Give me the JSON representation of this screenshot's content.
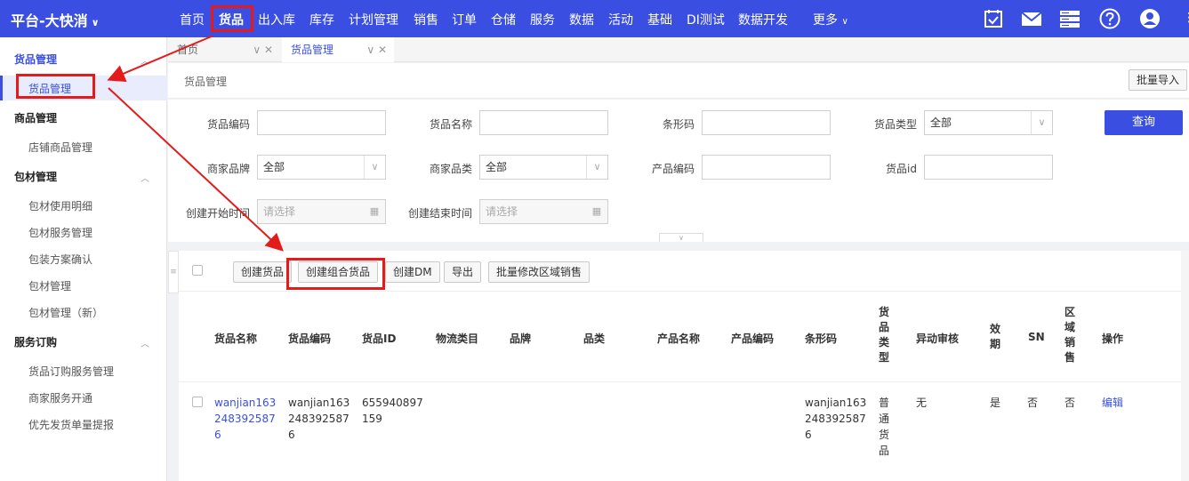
{
  "topnav": {
    "brand": "平台-大快消",
    "items": [
      "首页",
      "货品",
      "出入库",
      "库存",
      "计划管理",
      "销售",
      "订单",
      "仓储",
      "服务",
      "数据",
      "活动",
      "基础",
      "DI测试",
      "数据开发",
      "更多"
    ],
    "active": "货品",
    "icons": [
      "calendar-check-icon",
      "mail-icon",
      "server-icon",
      "help-icon",
      "user-icon"
    ]
  },
  "sidebar": {
    "groups": [
      {
        "title": "货品管理",
        "items": [
          "货品管理"
        ]
      },
      {
        "title": "商品管理",
        "items": [
          "店铺商品管理"
        ]
      },
      {
        "title": "包材管理",
        "items": [
          "包材使用明细",
          "包材服务管理",
          "包装方案确认",
          "包材管理",
          "包材管理（新）"
        ]
      },
      {
        "title": "服务订购",
        "items": [
          "货品订购服务管理",
          "商家服务开通",
          "优先发货单量提报"
        ]
      }
    ],
    "active_item": "货品管理"
  },
  "tabs": [
    {
      "label": "首页"
    },
    {
      "label": "货品管理"
    }
  ],
  "breadcrumb": "货品管理",
  "batch_import": "批量导入",
  "filters": {
    "goods_code": {
      "label": "货品编码",
      "value": ""
    },
    "goods_name": {
      "label": "货品名称",
      "value": ""
    },
    "barcode": {
      "label": "条形码",
      "value": ""
    },
    "goods_type": {
      "label": "货品类型",
      "value": "全部"
    },
    "merchant_brand": {
      "label": "商家品牌",
      "value": "全部"
    },
    "merchant_category": {
      "label": "商家品类",
      "value": "全部"
    },
    "product_code": {
      "label": "产品编码",
      "value": ""
    },
    "goods_id": {
      "label": "货品id",
      "value": ""
    },
    "created_start": {
      "label": "创建开始时间",
      "placeholder": "请选择"
    },
    "created_end": {
      "label": "创建结束时间",
      "placeholder": "请选择"
    }
  },
  "query_button": "查询",
  "toolbar": {
    "create_goods": "创建货品",
    "create_combo_goods": "创建组合货品",
    "create_dm": "创建DM",
    "export": "导出",
    "batch_modify_region_sales": "批量修改区域销售"
  },
  "table": {
    "columns": [
      "货品名称",
      "货品编码",
      "货品ID",
      "物流类目",
      "品牌",
      "品类",
      "产品名称",
      "产品编码",
      "条形码",
      "货品类型",
      "异动审核",
      "效期",
      "SN",
      "区域销售",
      "操作"
    ],
    "rows": [
      {
        "name": [
          "wanjian163",
          "248392587",
          "6"
        ],
        "code": [
          "wanjian163",
          "248392587",
          "6"
        ],
        "id": [
          "655940897",
          "159"
        ],
        "logistics_category": "",
        "brand": "",
        "category": "",
        "product_name": "",
        "product_code": "",
        "barcode": [
          "wanjian163",
          "248392587",
          "6"
        ],
        "type": "普通货品",
        "change_review": "无",
        "expiry": "是",
        "sn": "否",
        "region_sales": "否",
        "action": "编辑"
      }
    ]
  },
  "colors": {
    "primary": "#3a4fe1",
    "annotation": "#e41b1b"
  }
}
